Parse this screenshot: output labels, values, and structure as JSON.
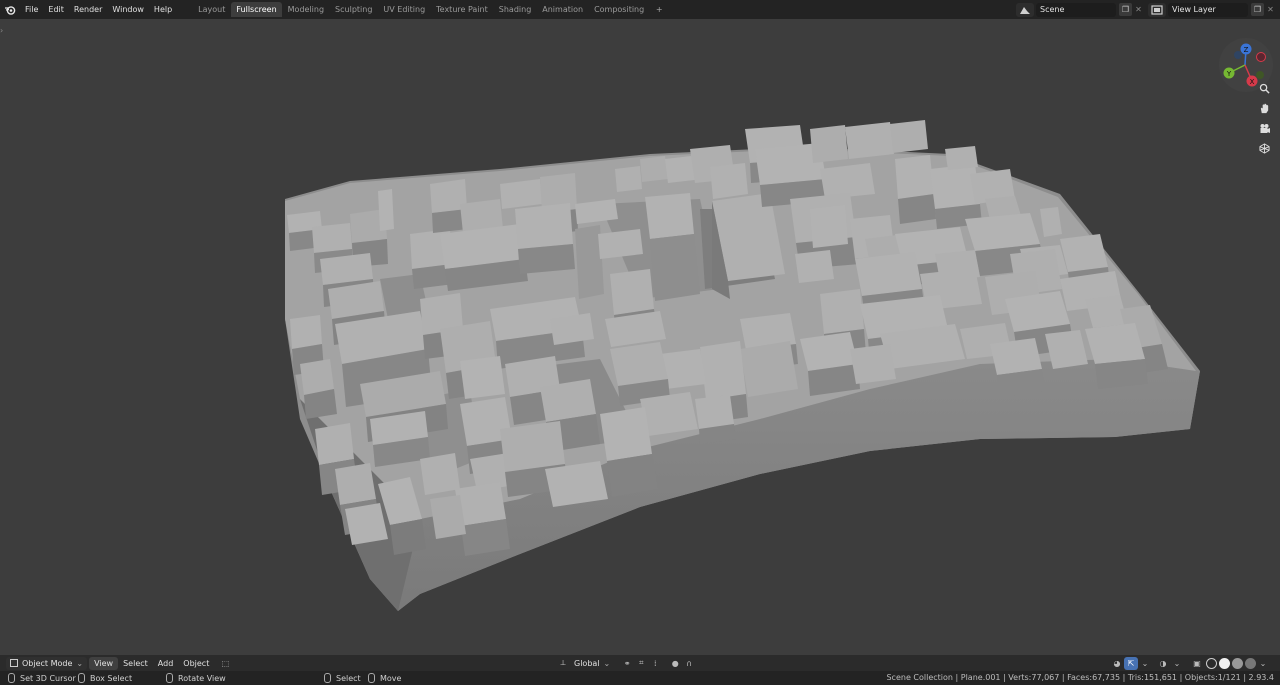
{
  "topbar": {
    "menus": [
      "File",
      "Edit",
      "Render",
      "Window",
      "Help"
    ],
    "workspaces": [
      "Layout",
      "Fullscreen",
      "Modeling",
      "Sculpting",
      "UV Editing",
      "Texture Paint",
      "Shading",
      "Animation",
      "Compositing"
    ],
    "active_workspace": "Fullscreen",
    "add_label": "+",
    "scene_label": "Scene",
    "view_layer_label": "View Layer"
  },
  "gizmo": {
    "z": "Z",
    "y": "Y",
    "x": "X"
  },
  "header": {
    "mode": "Object Mode",
    "menus": [
      "View",
      "Select",
      "Add",
      "Object"
    ],
    "transform_orientation": "Global"
  },
  "status": {
    "hints": [
      "Set 3D Cursor",
      "Box Select",
      "Rotate View",
      "Select",
      "Move"
    ],
    "stats": "Scene Collection | Plane.001 | Verts:77,067 | Faces:67,735 | Tris:151,651 | Objects:1/121 | 2.93.4"
  },
  "colors": {
    "topbar_bg": "#232323",
    "viewport_bg": "#3d3d3d",
    "active_blue": "#4772b3",
    "axis_x": "#d63a4a",
    "axis_y": "#76b833",
    "axis_z": "#3a74d6"
  },
  "icons": [
    "blender-logo-icon",
    "scene-icon",
    "view-layer-icon",
    "zoom-icon",
    "hand-icon",
    "camera-icon",
    "grid-icon",
    "mode-cube-icon",
    "mouse-icon"
  ]
}
